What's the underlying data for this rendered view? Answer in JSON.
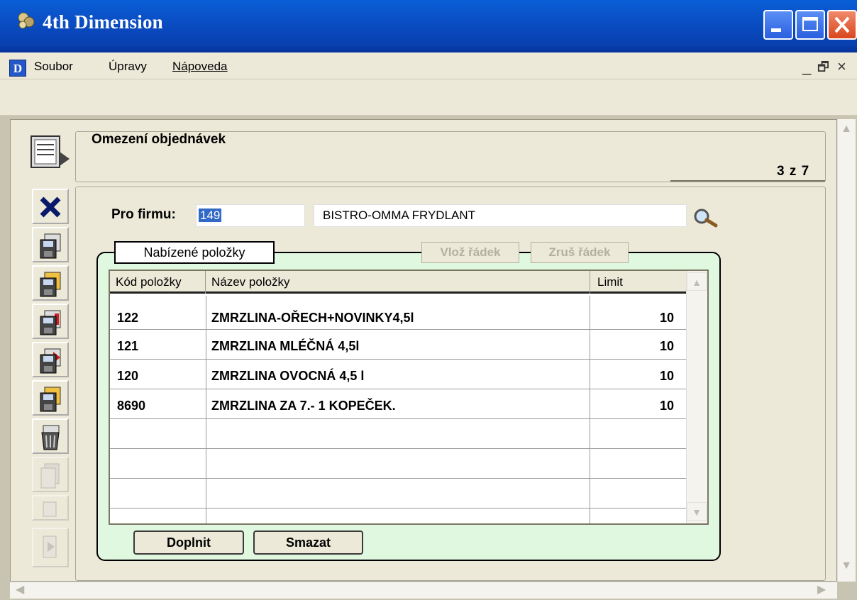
{
  "window": {
    "title": "4th Dimension"
  },
  "menu": {
    "items": [
      "Soubor",
      "Úpravy",
      "Nápoveda"
    ],
    "logo": "D"
  },
  "form": {
    "title": "Omezení objednávek",
    "record_position": "3 z 7"
  },
  "firm": {
    "label": "Pro firmu:",
    "code": "149",
    "name": "BISTRO-OMMA FRYDLANT"
  },
  "group": {
    "tab_label": "Nabízené položky",
    "insert_row": "Vlož řádek",
    "delete_row": "Zruš řádek"
  },
  "table": {
    "headers": [
      "Kód položky",
      "Název položky",
      "Limit"
    ],
    "rows": [
      {
        "code": "122",
        "name": "ZMRZLINA-OŘECH+NOVINKY4,5l",
        "limit": "10"
      },
      {
        "code": "121",
        "name": "ZMRZLINA MLÉČNÁ 4,5l",
        "limit": "10"
      },
      {
        "code": "120",
        "name": "ZMRZLINA OVOCNÁ 4,5 l",
        "limit": "10"
      },
      {
        "code": "8690",
        "name": "ZMRZLINA ZA 7.- 1 KOPEČEK.",
        "limit": "10"
      }
    ]
  },
  "buttons": {
    "add": "Doplnit",
    "delete": "Smazat"
  },
  "icons": {
    "app": "4d-app-icon",
    "form": "form-list-icon",
    "cancel": "close-x-icon",
    "save": "floppy-disk-icon",
    "search": "magnifier-icon",
    "scroll_up": "chevron-up-icon",
    "scroll_down": "chevron-down-icon"
  },
  "colors": {
    "titlebar": "#0a4ec4",
    "group_bg": "#e0f7e0",
    "selection": "#3169c6",
    "window_bg": "#ece9d8"
  }
}
